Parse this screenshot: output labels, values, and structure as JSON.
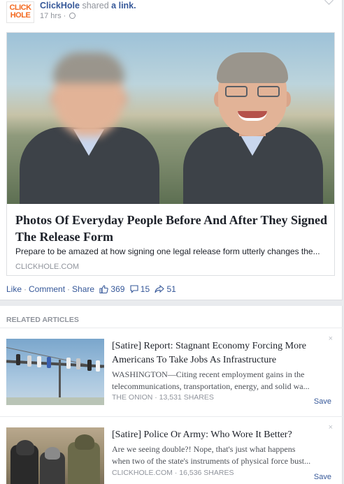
{
  "post": {
    "author": "ClickHole",
    "verb": "shared",
    "object": "a link.",
    "time": "17 hrs",
    "logo_lines": [
      "CLICK",
      "HOLE"
    ],
    "card": {
      "title": "Photos Of Everyday People Before And After They Signed The Release Form",
      "description": "Prepare to be amazed at how signing one legal release form utterly changes the...",
      "domain": "CLICKHOLE.COM"
    },
    "actions": {
      "like": "Like",
      "comment": "Comment",
      "share": "Share",
      "likes_count": "369",
      "comments_count": "15",
      "shares_count": "51"
    }
  },
  "related": {
    "header": "RELATED ARTICLES",
    "items": [
      {
        "title": "[Satire] Report: Stagnant Economy Forcing More Americans To Take Jobs As Infrastructure",
        "desc_lines": [
          "WASHINGTON—Citing recent employment gains in the",
          "telecommunications, transportation, energy, and solid wa..."
        ],
        "meta": "THE ONION · 13,531 SHARES",
        "save": "Save",
        "close": "×"
      },
      {
        "title": "[Satire] Police Or Army: Who Wore It Better?",
        "desc_lines": [
          "Are we seeing double?! Nope, that's just what happens",
          "when two of the state's instruments of physical force bust..."
        ],
        "meta": "CLICKHOLE.COM · 16,536 SHARES",
        "save": "Save",
        "close": "×"
      }
    ]
  },
  "colors": {
    "link": "#365899",
    "muted": "#90949c",
    "brand_orange": "#f3681e",
    "background": "#e9ebee"
  }
}
